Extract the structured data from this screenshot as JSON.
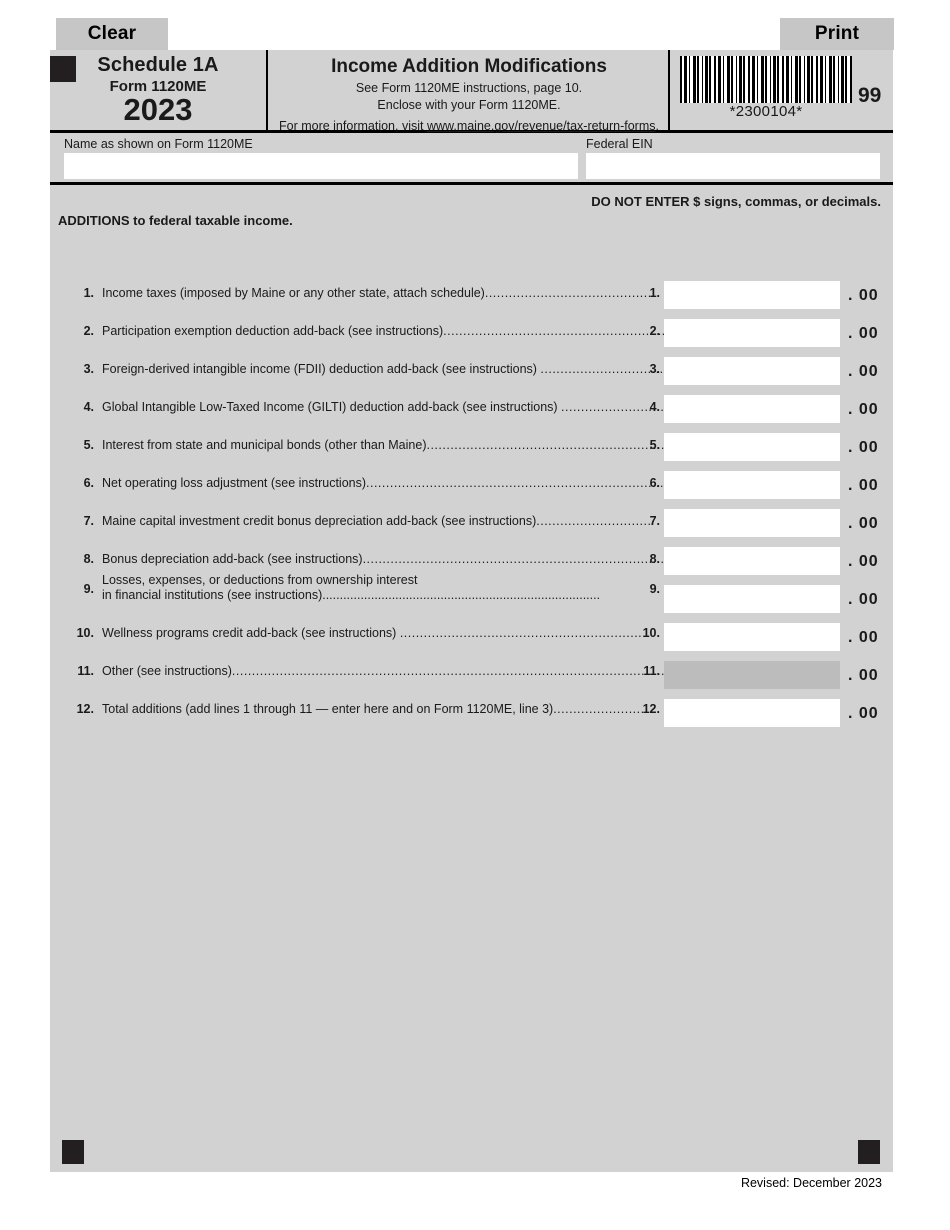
{
  "toolbar": {
    "clear_label": "Clear",
    "print_label": "Print"
  },
  "header": {
    "schedule_title": "Schedule 1A",
    "form_number": "Form 1120ME",
    "tax_year": "2023",
    "form_title": "Income Addition Modifications",
    "instruction_line_1": "See Form 1120ME instructions, page 10.",
    "instruction_line_2": "Enclose with your Form 1120ME.",
    "more_info_prefix": "For more information, visit ",
    "more_info_link": "www.maine.gov/revenue/tax-return-forms",
    "more_info_suffix": ".",
    "barcode_text": "*2300104*",
    "page_code": "99"
  },
  "identity": {
    "name_caption": "Name as shown on Form 1120ME",
    "name_value": "",
    "ein_caption": "Federal EIN",
    "ein_value": ""
  },
  "body": {
    "notice": "DO NOT ENTER $ signs, commas, or decimals.",
    "section_heading": "ADDITIONS to federal taxable income.",
    "cents_suffix": ". 00"
  },
  "lines": [
    {
      "number": "1.",
      "description": "Income taxes (imposed by Maine or any other state, attach schedule)",
      "leader": "...........................................",
      "ref": "1.",
      "value": "",
      "locked": false
    },
    {
      "number": "2.",
      "description": "Participation exemption deduction add-back (see instructions)",
      "leader": "........................................................",
      "ref": "2.",
      "value": "",
      "locked": false
    },
    {
      "number": "3.",
      "description": "Foreign-derived intangible income (FDII) deduction add-back (see instructions) ",
      "leader": "...............................",
      "ref": "3.",
      "value": "",
      "locked": false
    },
    {
      "number": "4.",
      "description": "Global Intangible Low-Taxed Income (GILTI) deduction add-back (see instructions) ",
      "leader": "..........................",
      "ref": "4.",
      "value": "",
      "locked": false
    },
    {
      "number": "5.",
      "description": "Interest from state and municipal bonds (other than Maine)",
      "leader": "............................................................",
      "ref": "5.",
      "value": "",
      "locked": false
    },
    {
      "number": "6.",
      "description": "Net operating loss adjustment (see instructions)",
      "leader": "...............................................................................",
      "ref": "6.",
      "value": "",
      "locked": false
    },
    {
      "number": "7.",
      "description": "Maine capital investment credit bonus depreciation add-back (see instructions)",
      "leader": ".............................",
      "ref": "7.",
      "value": "",
      "locked": false
    },
    {
      "number": "8.",
      "description": "Bonus depreciation add-back (see instructions)",
      "leader": "...................................................................................",
      "ref": "8.",
      "value": "",
      "locked": false
    },
    {
      "number": "9.",
      "description_line_1": "Losses, expenses, or deductions from ownership interest",
      "description_line_2": "in financial institutions (see instructions)",
      "leader": "................................................................................",
      "ref": "9.",
      "value": "",
      "locked": false
    },
    {
      "number": "10.",
      "description": "Wellness programs credit add-back (see instructions) ",
      "leader": "...............................................................",
      "ref": "10.",
      "value": "",
      "locked": false
    },
    {
      "number": "11.",
      "description": "Other (see instructions)",
      "leader": "..............................................................................................................................",
      "ref": "11.",
      "value": "",
      "locked": true
    },
    {
      "number": "12.",
      "description": "Total additions (add lines 1 through 11 — enter here and on Form 1120ME, line 3)",
      "leader": ".......................",
      "ref": "12.",
      "value": "",
      "locked": false
    }
  ],
  "footer": {
    "revised": "Revised: December 2023"
  }
}
